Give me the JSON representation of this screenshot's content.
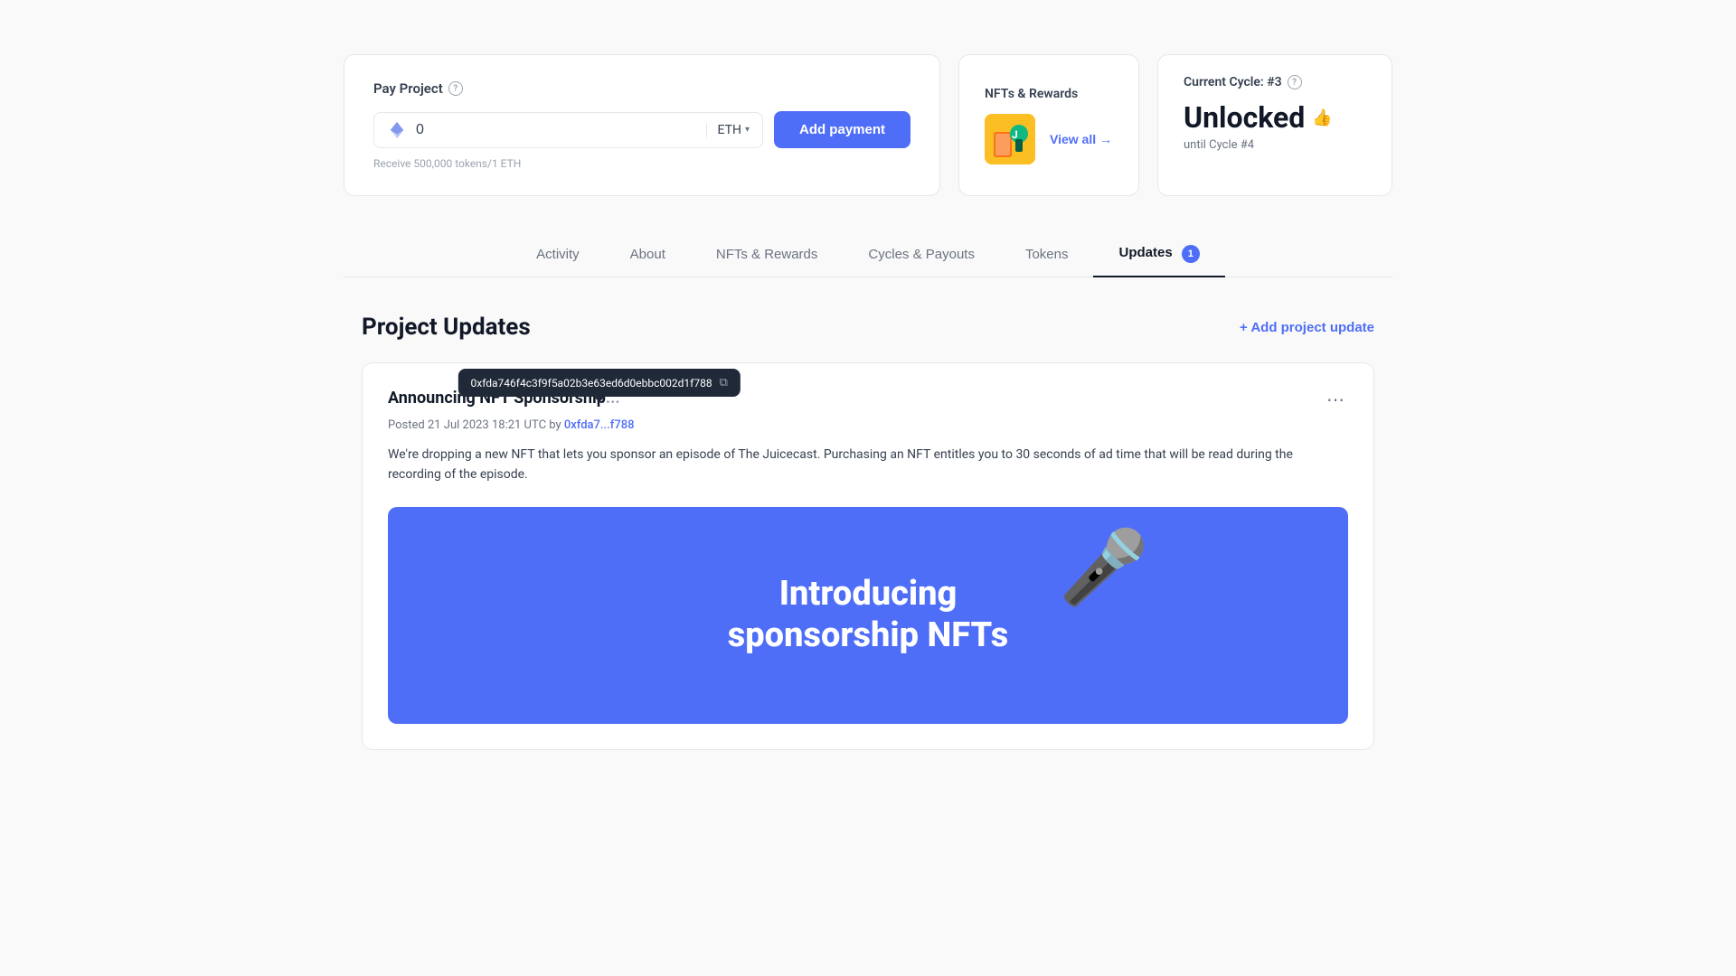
{
  "page": {
    "pay_project": {
      "title": "Pay Project",
      "info_icon": "?",
      "input_placeholder": "0",
      "eth_label": "ETH",
      "button_label": "Add payment",
      "hint": "Receive 500,000 tokens/1 ETH"
    },
    "nfts_rewards": {
      "title": "NFTs & Rewards",
      "view_all_label": "View all",
      "view_all_arrow": "→"
    },
    "current_cycle": {
      "title": "Current Cycle: #3",
      "status": "Unlocked",
      "until": "until Cycle #4"
    },
    "nav": {
      "tabs": [
        {
          "id": "activity",
          "label": "Activity",
          "active": false,
          "badge": null
        },
        {
          "id": "about",
          "label": "About",
          "active": false,
          "badge": null
        },
        {
          "id": "nfts",
          "label": "NFTs & Rewards",
          "active": false,
          "badge": null
        },
        {
          "id": "cycles",
          "label": "Cycles & Payouts",
          "active": false,
          "badge": null
        },
        {
          "id": "tokens",
          "label": "Tokens",
          "active": false,
          "badge": null
        },
        {
          "id": "updates",
          "label": "Updates",
          "active": true,
          "badge": "1"
        }
      ]
    },
    "updates_section": {
      "title": "Project Updates",
      "add_button": "+ Add project update",
      "update_card": {
        "title": "Announcing ...",
        "full_title": "Announcing NFT Sponsorship...",
        "meta_prefix": "Posted 21 Jul 2023 18:21 UTC by ",
        "author_short": "0xfda7...f788",
        "author_full": "0xfda746f4c3f9f5a02b3e63ed6d0ebbc002d1f788",
        "body": "We're dropping a new NFT that lets you sponsor an episode of The Juicecast. Purchasing an NFT entitles you to 30 seconds of ad time that will be read during the recording of the episode.",
        "tooltip": {
          "address": "0xfda746f4c3f9f5a02b3e63ed6d0ebbc002d1f788",
          "copy_icon": "⧉"
        },
        "banner": {
          "line1": "Introducing",
          "line2": "sponsorship NFTs"
        }
      }
    }
  }
}
